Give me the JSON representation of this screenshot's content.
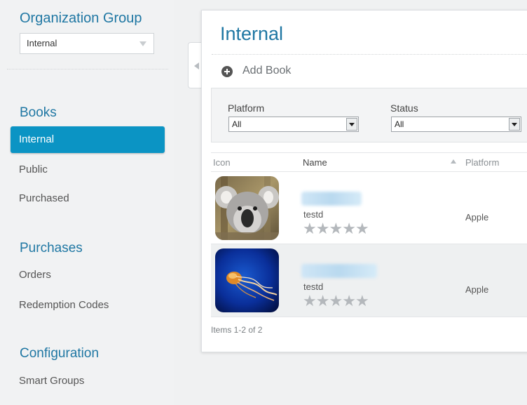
{
  "sidebar": {
    "org_group_title": "Organization Group",
    "org_group_value": "Internal",
    "sections": [
      {
        "title": "Books",
        "items": [
          {
            "label": "Internal",
            "active": true
          },
          {
            "label": "Public",
            "active": false
          },
          {
            "label": "Purchased",
            "active": false
          }
        ]
      },
      {
        "title": "Purchases",
        "items": [
          {
            "label": "Orders",
            "active": false
          },
          {
            "label": "Redemption Codes",
            "active": false
          }
        ]
      },
      {
        "title": "Configuration",
        "items": [
          {
            "label": "Smart Groups",
            "active": false
          }
        ]
      }
    ]
  },
  "main": {
    "title": "Internal",
    "add_book_label": "Add Book",
    "filters": [
      {
        "label": "Platform",
        "value": "All"
      },
      {
        "label": "Status",
        "value": "All"
      }
    ],
    "table": {
      "columns": [
        "Icon",
        "Name",
        "Platform"
      ],
      "rows": [
        {
          "icon": "koala-image",
          "owner": "testd",
          "rating": 0,
          "platform": "Apple"
        },
        {
          "icon": "jellyfish-image",
          "owner": "testd",
          "rating": 0,
          "platform": "Apple"
        }
      ]
    },
    "items_count": "Items 1-2 of 2"
  },
  "colors": {
    "accent": "#1f77a3",
    "active_nav": "#0b94c4",
    "star_empty": "#b4b8bc"
  },
  "icons": {
    "add": "plus-circle-icon",
    "collapse": "chevron-left-icon",
    "sort": "sort-ascending-icon",
    "star": "star-icon"
  }
}
